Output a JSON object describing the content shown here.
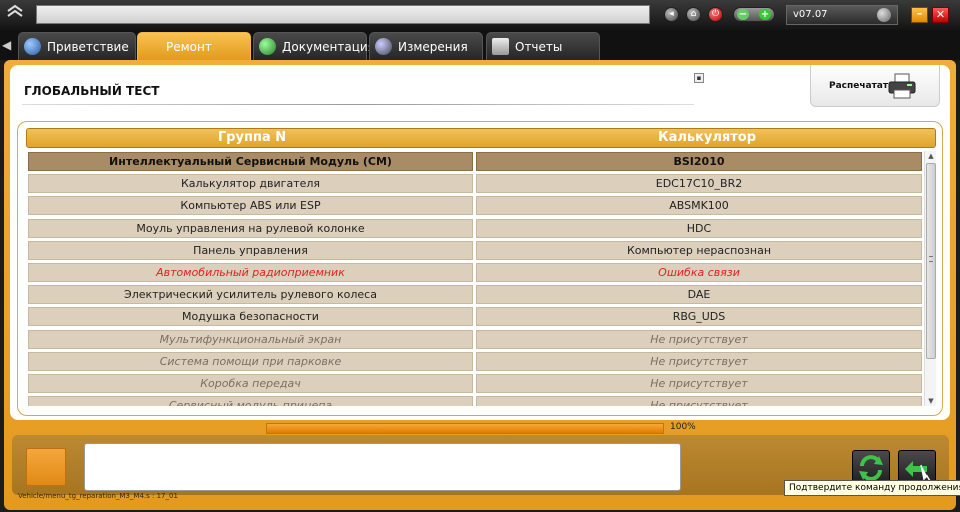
{
  "header": {
    "version": "v07.07"
  },
  "tabs": [
    {
      "label": "Приветствие",
      "icon": "globe-icon"
    },
    {
      "label": "Ремонт",
      "icon": "magnifier-icon",
      "active": true
    },
    {
      "label": "Документация",
      "icon": "book-icon"
    },
    {
      "label": "Измерения",
      "icon": "waveform-icon"
    },
    {
      "label": "Отчеты",
      "icon": "document-icon"
    }
  ],
  "page": {
    "title": "ГЛОБАЛЬНЫЙ ТЕСТ",
    "print_label": "Распечатать"
  },
  "table": {
    "columns": [
      "Группа N",
      "Калькулятор"
    ],
    "rows": [
      {
        "group": "Интеллектуальный Сервисный Модуль (CM)",
        "calc": "BSI2010",
        "style": "header"
      },
      {
        "group": "Калькулятор двигателя",
        "calc": "EDC17C10_BR2",
        "style": "normal"
      },
      {
        "group": "Компьютер ABS или ESP",
        "calc": "ABSMK100",
        "style": "normal"
      },
      {
        "group": "Моуль управления на рулевой колонке",
        "calc": "HDC",
        "style": "normal"
      },
      {
        "group": "Панель управления",
        "calc": "Компьютер нераспознан",
        "style": "normal"
      },
      {
        "group": "Автомобильный радиоприемник",
        "calc": "Ошибка связи",
        "style": "error"
      },
      {
        "group": "Электрический усилитель рулевого колеса",
        "calc": "DAE",
        "style": "normal"
      },
      {
        "group": "Модушка безопасности",
        "calc": "RBG_UDS",
        "style": "normal"
      },
      {
        "group": "Мультифункциональный экран",
        "calc": "Не присутствует",
        "style": "absent"
      },
      {
        "group": "Система помощи при парковке",
        "calc": "Не присутствует",
        "style": "absent"
      },
      {
        "group": "Коробка передач",
        "calc": "Не присутствует",
        "style": "absent"
      },
      {
        "group": "Сервисный модуль прицепа",
        "calc": "Не присутствует",
        "style": "absent"
      }
    ]
  },
  "progress": {
    "value": 100,
    "label": "100%"
  },
  "footer": {
    "status_path": "Vehicle/menu_tg_reparation_M3_M4.s : 17_01",
    "tooltip": "Подтвердите команду продолжения (ОК)"
  },
  "colors": {
    "accent": "#e39a1e",
    "header_row": "#a98c66",
    "row_bg": "#dcd0bc",
    "error_text": "#e02020"
  }
}
